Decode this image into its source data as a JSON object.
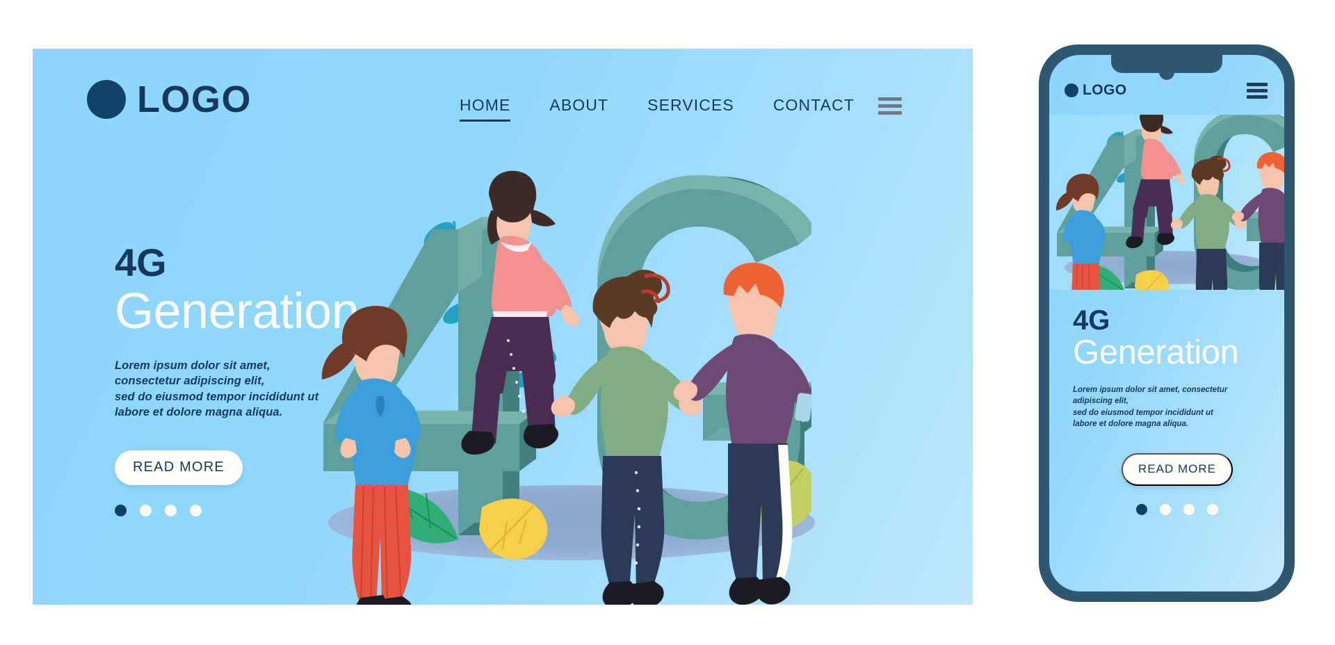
{
  "theme": {
    "panel_bg_start": "#8ed6fb",
    "panel_bg_end": "#bce7fd",
    "navy": "#15385c",
    "white": "#fdfdfa",
    "letter_teal_front": "#5f9f9c",
    "letter_teal_top": "#79b3ad",
    "letter_teal_side": "#3f7c7d",
    "phone_bezel": "#2e5872",
    "ground_shadow": "#8ba8cd"
  },
  "desktop": {
    "logo": {
      "text": "LOGO",
      "icon": "circle-dot"
    },
    "nav": {
      "items": [
        {
          "label": "HOME",
          "active": true
        },
        {
          "label": "ABOUT",
          "active": false
        },
        {
          "label": "SERVICES",
          "active": false
        },
        {
          "label": "CONTACT",
          "active": false
        }
      ],
      "menu_icon": "hamburger-icon"
    },
    "hero": {
      "title_top": "4G",
      "title_bottom": "Generation",
      "paragraph_lines": [
        "Lorem ipsum dolor sit amet, consectetur adipiscing elit,",
        "sed do eiusmod tempor incididunt ut",
        "labore et dolore magna aliqua."
      ],
      "cta_label": "READ MORE",
      "carousel": {
        "count": 4,
        "active_index": 0
      }
    },
    "illustration": {
      "letters": "4G",
      "characters": [
        {
          "name": "woman-pink-top-sitting",
          "top_color": "#f2918f",
          "pants_color": "#4a2d53"
        },
        {
          "name": "woman-blue-top-standing",
          "top_color": "#3d9ede",
          "pants_color": "#e8533f"
        },
        {
          "name": "woman-green-sweater",
          "top_color": "#81ac84",
          "pants_color": "#2b3a56"
        },
        {
          "name": "man-purple-sweater",
          "top_color": "#6c4a74",
          "pants_color": "#2b3a56"
        }
      ],
      "foliage": [
        "teal-branch",
        "green-leaf",
        "yellow-maple-leaf",
        "olive-oak-leaf",
        "blue-leaf"
      ]
    }
  },
  "phone": {
    "logo": {
      "text": "LOGO",
      "icon": "circle-dot"
    },
    "menu_icon": "hamburger-icon",
    "hero": {
      "title_top": "4G",
      "title_bottom": "Generation",
      "paragraph_lines": [
        "Lorem ipsum dolor sit amet, consectetur adipiscing elit,",
        "sed do eiusmod tempor incididunt ut",
        "labore et dolore magna aliqua."
      ],
      "cta_label": "READ MORE",
      "carousel": {
        "count": 4,
        "active_index": 0
      }
    }
  }
}
